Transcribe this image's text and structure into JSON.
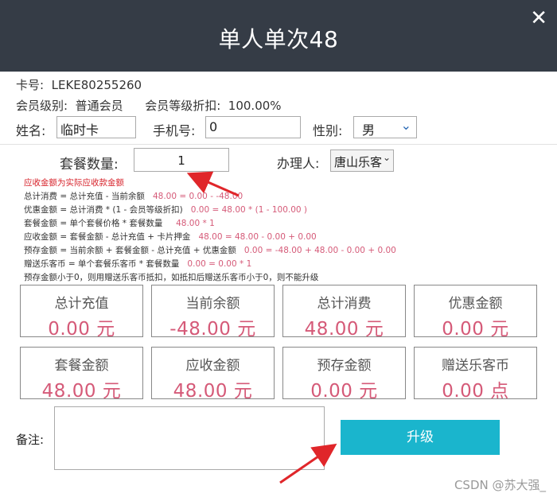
{
  "dialog": {
    "title": "单人单次48",
    "close_glyph": "✕"
  },
  "member": {
    "card_label": "卡号:",
    "card_number": "LEKE80255260",
    "level_label": "会员级别:",
    "level_value": "普通会员",
    "discount_label": "会员等级折扣:",
    "discount_value": "100.00%",
    "name_label": "姓名:",
    "name_value": "临时卡",
    "phone_label": "手机号:",
    "phone_value": "0",
    "gender_label": "性别:",
    "gender_value": "男"
  },
  "package": {
    "qty_label": "套餐数量:",
    "qty_value": "1",
    "handler_label": "办理人:",
    "handler_value": "唐山乐客"
  },
  "formulas": {
    "note": "应收金额为实际应收款金额",
    "lines": [
      {
        "formula": "总计消费 = 总计充值 - 当前余额",
        "values": "48.00 = 0.00 - -48.00"
      },
      {
        "formula": "优惠金额 = 总计消费 * (1 - 会员等级折扣)",
        "values": "0.00 = 48.00 * (1 - 100.00 )"
      },
      {
        "formula": "套餐金额 = 单个套餐价格 * 套餐数量",
        "values": "48.00 * 1"
      },
      {
        "formula": "应收金额 = 套餐金额 - 总计充值 + 卡片押金",
        "values": "48.00 = 48.00 - 0.00 + 0.00"
      },
      {
        "formula": "预存金额 = 当前余额 + 套餐金额 - 总计充值 + 优惠金额",
        "values": "0.00 = -48.00 + 48.00 - 0.00 + 0.00"
      },
      {
        "formula": "赠送乐客币 = 单个套餐乐客币 * 套餐数量",
        "values": "0.00 = 0.00 * 1"
      }
    ],
    "warning": "预存金额小于0，则用赠送乐客币抵扣，如抵扣后赠送乐客币小于0，则不能升级"
  },
  "cards": [
    {
      "label": "总计充值",
      "value": "0.00 元"
    },
    {
      "label": "当前余额",
      "value": "-48.00 元"
    },
    {
      "label": "总计消费",
      "value": "48.00 元"
    },
    {
      "label": "优惠金额",
      "value": "0.00 元"
    },
    {
      "label": "套餐金额",
      "value": "48.00 元"
    },
    {
      "label": "应收金额",
      "value": "48.00 元"
    },
    {
      "label": "预存金额",
      "value": "0.00 元"
    },
    {
      "label": "赠送乐客币",
      "value": "0.00 点"
    }
  ],
  "remark": {
    "label": "备注:",
    "value": ""
  },
  "actions": {
    "upgrade_label": "升级"
  },
  "watermark": "CSDN @苏大强_",
  "colors": {
    "titlebar": "#353c46",
    "accent": "#1ab5cd",
    "value": "#d55a78",
    "note": "#d7232b",
    "arrow": "#e0262a"
  }
}
